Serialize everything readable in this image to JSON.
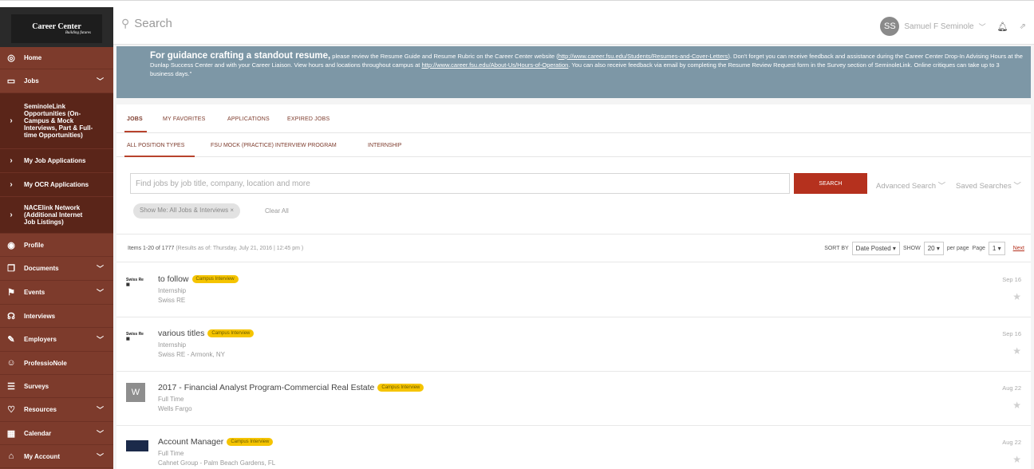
{
  "sidebar": {
    "logo_main": "Career Center",
    "logo_sub": "Building futures",
    "items": [
      {
        "label": "Home",
        "icon": "home-icon",
        "chevron": false
      },
      {
        "label": "Jobs",
        "icon": "briefcase-icon",
        "chevron": true
      },
      {
        "label": "SeminoleLink Opportunities (On-Campus & Mock Interviews, Part & Full-time Opportunities)",
        "icon": "chevron-right-icon",
        "chevron": false,
        "sub": true
      },
      {
        "label": "My Job Applications",
        "icon": "chevron-right-icon",
        "chevron": false,
        "sub": true
      },
      {
        "label": "My OCR Applications",
        "icon": "chevron-right-icon",
        "chevron": false,
        "sub": true
      },
      {
        "label": "NACElink Network (Additional Internet Job Listings)",
        "icon": "chevron-right-icon",
        "chevron": false,
        "sub": true
      },
      {
        "label": "Profile",
        "icon": "profile-icon",
        "chevron": false
      },
      {
        "label": "Documents",
        "icon": "documents-icon",
        "chevron": true
      },
      {
        "label": "Events",
        "icon": "events-icon",
        "chevron": true
      },
      {
        "label": "Interviews",
        "icon": "interviews-icon",
        "chevron": false
      },
      {
        "label": "Employers",
        "icon": "employers-icon",
        "chevron": true
      },
      {
        "label": "ProfessioNole",
        "icon": "professionole-icon",
        "chevron": false
      },
      {
        "label": "Surveys",
        "icon": "surveys-icon",
        "chevron": false
      },
      {
        "label": "Resources",
        "icon": "resources-icon",
        "chevron": true
      },
      {
        "label": "Calendar",
        "icon": "calendar-icon",
        "chevron": true
      },
      {
        "label": "My Account",
        "icon": "account-icon",
        "chevron": true
      }
    ]
  },
  "topbar": {
    "search_placeholder": "Search",
    "avatar_initials": "SS",
    "user_name": "Samuel F Seminole"
  },
  "banner": {
    "headline": "For guidance crafting a standout resume,",
    "text1": " please review the Resume Guide and Resume Rubric on the Career Center website (",
    "link1": "http://www.career.fsu.edu/Students/Resumes-and-Cover-Letters",
    "text2": "). Don't forget you can receive feedback and assistance during the Career Center Drop-In Advising Hours at the Dunlap Success Center and with your Career Liaison. View hours and locations throughout campus at ",
    "link2": "http://www.career.fsu.edu/About-Us/Hours-of-Operation",
    "text3": ". You can also receive feedback via email by completing the Resume Review Request form in the Survey section of SeminoleLink. Online critiques can take up to 3 business days.\""
  },
  "tabs": [
    "JOBS",
    "MY FAVORITES",
    "APPLICATIONS",
    "EXPIRED JOBS"
  ],
  "subtabs": [
    "ALL POSITION TYPES",
    "FSU MOCK (PRACTICE) INTERVIEW PROGRAM",
    "INTERNSHIP"
  ],
  "job_search": {
    "placeholder": "Find jobs by job title, company, location and more",
    "button": "SEARCH",
    "advanced": "Advanced Search",
    "saved": "Saved Searches",
    "filter_chip": "Show Me: All Jobs & Interviews",
    "clear_all": "Clear All"
  },
  "results": {
    "items": "Items 1-20 of 1777",
    "as_of": "(Results as of: Thursday, July 21, 2016 | 12:45 pm )",
    "sort_label": "SORT BY",
    "sort_value": "Date Posted",
    "show_label": "SHOW",
    "show_value": "20",
    "per_page": "per page",
    "page_label": "Page",
    "page_value": "1",
    "next": "Next"
  },
  "jobs": [
    {
      "title": "to follow",
      "badge": "Campus Interview",
      "type": "Internship",
      "employer": "Swiss RE",
      "date": "Sep 16",
      "logo": "Swiss Re"
    },
    {
      "title": "various titles",
      "badge": "Campus Interview",
      "type": "Internship",
      "employer": "Swiss RE - Armonk, NY",
      "date": "Sep 16",
      "logo": "Swiss Re"
    },
    {
      "title": "2017 - Financial Analyst Program-Commercial Real Estate",
      "badge": "Campus Interview",
      "type": "Full Time",
      "employer": "Wells Fargo",
      "date": "Aug 22",
      "logo": "W"
    },
    {
      "title": "Account Manager",
      "badge": "Campus Interview",
      "type": "Full Time",
      "employer": "Cahnet Group - Palm Beach Gardens, FL",
      "date": "Aug 22",
      "logo": ""
    }
  ]
}
